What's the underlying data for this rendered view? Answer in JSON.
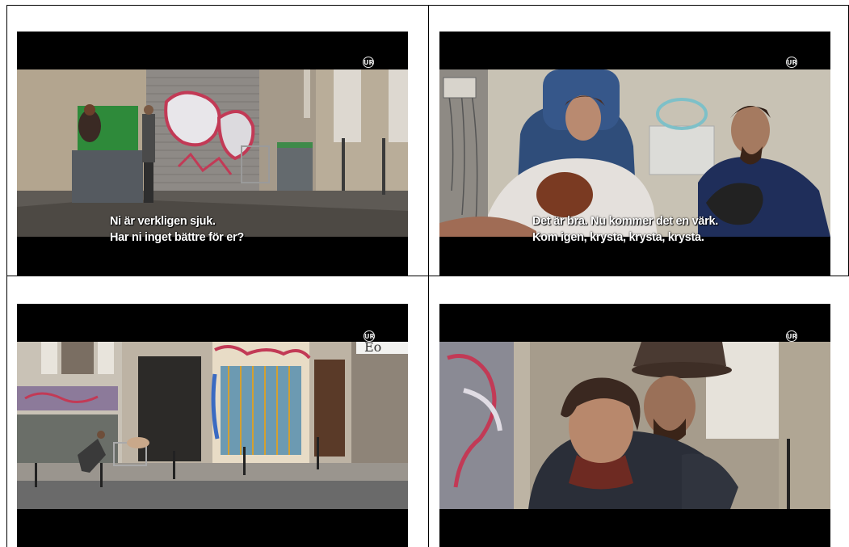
{
  "logo_text": "UR",
  "frames": [
    {
      "id": "frame-1",
      "subtitle_lines": [
        "Ni är verkligen sjuk.",
        "Har ni inget bättre för er?"
      ]
    },
    {
      "id": "frame-2",
      "subtitle_lines": [
        "Det är bra. Nu kommer det en värk.",
        "Kom igen, krysta, krysta, krysta."
      ]
    },
    {
      "id": "frame-3",
      "subtitle_lines": []
    },
    {
      "id": "frame-4",
      "subtitle_lines": []
    }
  ],
  "colors": {
    "border": "#000000",
    "letterbox": "#000000",
    "subtitle_text": "#ffffff"
  }
}
